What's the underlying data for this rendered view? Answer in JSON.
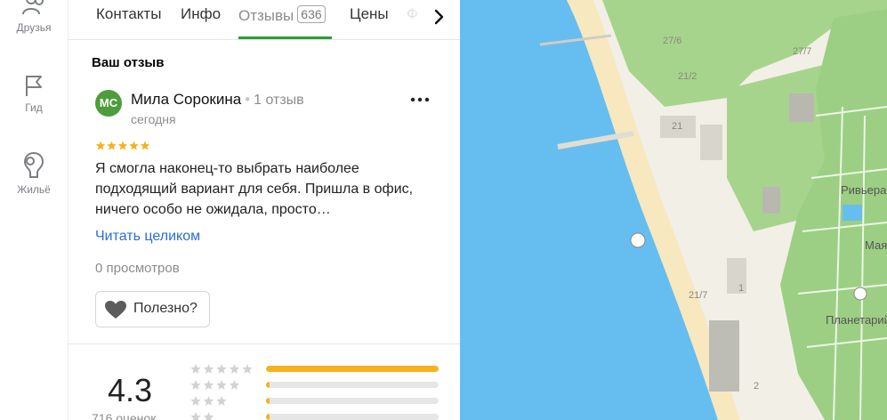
{
  "rail": {
    "items": [
      {
        "label": "Друзья",
        "icon": "friends-icon"
      },
      {
        "label": "Гид",
        "icon": "flag-icon"
      },
      {
        "label": "Жильё",
        "icon": "housing-icon"
      }
    ]
  },
  "tabs": {
    "items": [
      {
        "label": "Контакты"
      },
      {
        "label": "Инфо"
      },
      {
        "label": "Отзывы",
        "badge": "636"
      },
      {
        "label": "Цены"
      },
      {
        "label": "Ф"
      }
    ],
    "active": "Отзывы"
  },
  "review": {
    "section_title": "Ваш отзыв",
    "avatar_initials": "МС",
    "avatar_color": "#4d9d3c",
    "author": "Мила Сорокина",
    "author_reviews": "1 отзыв",
    "date": "сегодня",
    "stars": 5,
    "text": "Я смогла наконец-то выбрать наиболее подходящий вариант для себя. Пришла в офис, ничего особо не ожидала, просто…",
    "read_more": "Читать целиком",
    "views": "0 просмотров",
    "useful_label": "Полезно?"
  },
  "summary": {
    "rating": "4.3",
    "count_label": "716 оценок",
    "distribution": [
      {
        "stars": 5,
        "fraction": 1.0
      },
      {
        "stars": 4,
        "fraction": 0.02
      },
      {
        "stars": 3,
        "fraction": 0.02
      },
      {
        "stars": 2,
        "fraction": 0.02
      }
    ]
  },
  "map": {
    "labels": [
      {
        "text": "27/6"
      },
      {
        "text": "27/7"
      },
      {
        "text": "21/2"
      },
      {
        "text": "21"
      },
      {
        "text": "Ривьера"
      },
      {
        "text": "Мая"
      },
      {
        "text": "21/7"
      },
      {
        "text": "1"
      },
      {
        "text": "Планетарий"
      },
      {
        "text": "2"
      }
    ]
  },
  "colors": {
    "accent_green": "#2a9d34",
    "link_blue": "#2b6fd1",
    "star_gold": "#f6b21d",
    "sea": "#66bdf0",
    "park": "#a6d48c",
    "beach": "#f7e8bf"
  }
}
